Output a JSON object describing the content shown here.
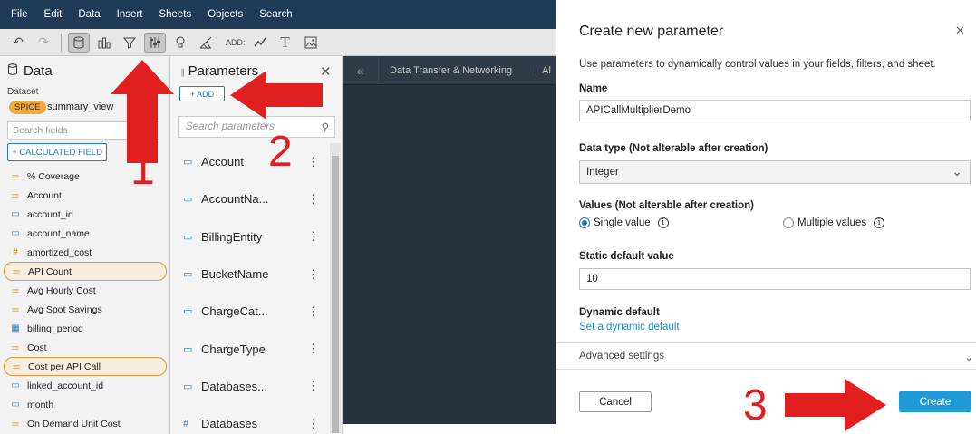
{
  "menu": [
    "File",
    "Edit",
    "Data",
    "Insert",
    "Sheets",
    "Objects",
    "Search"
  ],
  "toolbar": {
    "add_label": "ADD:"
  },
  "data_pane": {
    "title": "Data",
    "dataset_label": "Dataset",
    "spice": "SPICE",
    "dataset_name": "summary_view",
    "search_placeholder": "Search fields",
    "calc_button": "+ CALCULATED FIELD",
    "fields": [
      {
        "icon": "measure",
        "label": "% Coverage"
      },
      {
        "icon": "measure",
        "label": "Account"
      },
      {
        "icon": "dimension",
        "label": "account_id"
      },
      {
        "icon": "dimension",
        "label": "account_name"
      },
      {
        "icon": "hash",
        "label": "amortized_cost"
      },
      {
        "icon": "measure",
        "label": "API Count",
        "highlight": true
      },
      {
        "icon": "measure",
        "label": "Avg Hourly Cost"
      },
      {
        "icon": "measure",
        "label": "Avg Spot Savings"
      },
      {
        "icon": "calendar",
        "label": "billing_period"
      },
      {
        "icon": "measure",
        "label": "Cost"
      },
      {
        "icon": "measure",
        "label": "Cost per API Call",
        "highlight": true
      },
      {
        "icon": "dimension",
        "label": "linked_account_id"
      },
      {
        "icon": "dimension",
        "label": "month"
      },
      {
        "icon": "measure",
        "label": "On Demand Unit Cost"
      }
    ]
  },
  "param_pane": {
    "title": "Parameters",
    "add_button": "+ ADD",
    "search_placeholder": "Search parameters",
    "items": [
      {
        "icon": "string",
        "label": "Account"
      },
      {
        "icon": "string",
        "label": "AccountNa..."
      },
      {
        "icon": "string",
        "label": "BillingEntity"
      },
      {
        "icon": "string",
        "label": "BucketName"
      },
      {
        "icon": "string",
        "label": "ChargeCat..."
      },
      {
        "icon": "string",
        "label": "ChargeType"
      },
      {
        "icon": "string",
        "label": "Databases..."
      },
      {
        "icon": "hash",
        "label": "Databases"
      }
    ]
  },
  "sheet_tabs": {
    "tab1": "Data Transfer & Networking",
    "tab2": "Al"
  },
  "dialog": {
    "title": "Create new parameter",
    "description": "Use parameters to dynamically control values in your fields, filters, and sheet.",
    "name_label": "Name",
    "name_value": "APICallMultiplierDemo",
    "datatype_label": "Data type (Not alterable after creation)",
    "datatype_value": "Integer",
    "values_label": "Values (Not alterable after creation)",
    "single_value": "Single value",
    "multiple_values": "Multiple values",
    "static_default_label": "Static default value",
    "static_default_value": "10",
    "dynamic_default_label": "Dynamic default",
    "dynamic_default_link": "Set a dynamic default",
    "advanced_settings": "Advanced settings",
    "cancel": "Cancel",
    "create": "Create"
  },
  "annotations": {
    "step1": "1",
    "step2": "2",
    "step3": "3",
    "arrow_color": "#e21f1f"
  }
}
